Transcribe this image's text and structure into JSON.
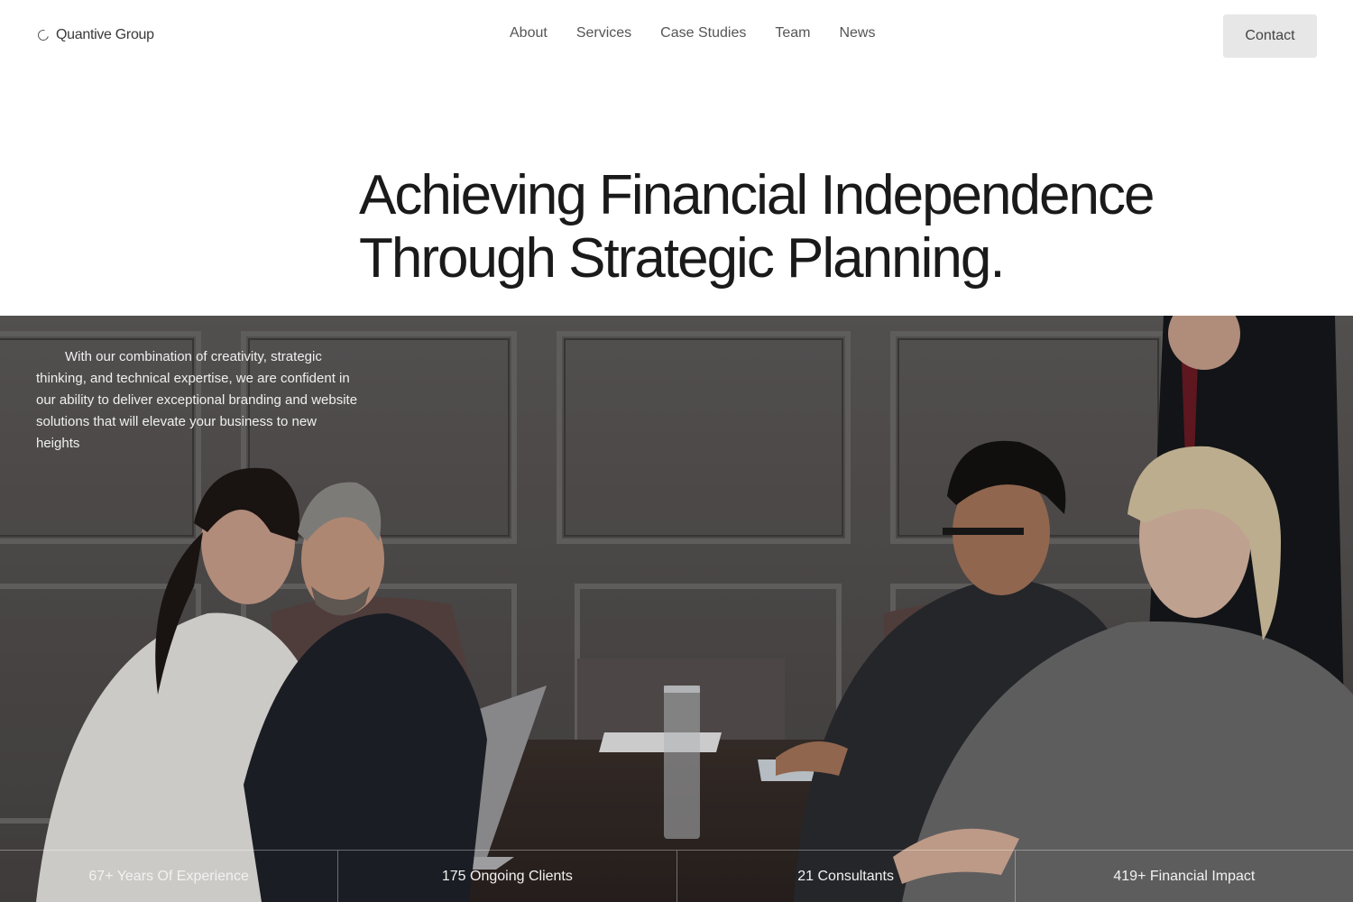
{
  "header": {
    "brand_name": "Quantive Group",
    "nav": [
      "About",
      "Services",
      "Case Studies",
      "Team",
      "News"
    ],
    "contact_label": "Contact"
  },
  "hero": {
    "title_line1": "Achieving Financial Independence",
    "title_line2": "Through Strategic Planning.",
    "intro": "With our combination of creativity, strategic thinking, and technical expertise, we are confident in our ability to deliver exceptional branding and website solutions that will elevate your business to new heights"
  },
  "stats": [
    "67+ Years Of Experience",
    "175 Ongoing Clients",
    "21 Consultants",
    "419+ Financial Impact"
  ],
  "colors": {
    "text_dark": "#1a1a1a",
    "button_bg": "#e7e7e7",
    "photo_wall": "#5b5757"
  }
}
